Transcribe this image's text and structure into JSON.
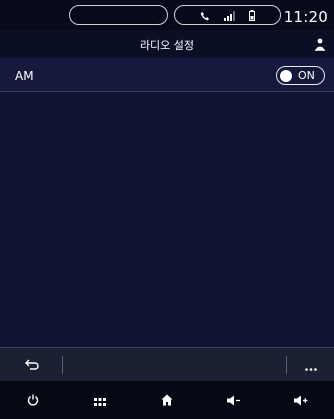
{
  "status": {
    "time": "11:20",
    "icons": [
      "phone-icon",
      "signal-icon",
      "battery-icon"
    ]
  },
  "header": {
    "title": "라디오 설정",
    "user_icon": "person-icon"
  },
  "settings": {
    "am_label": "AM",
    "am_toggle_state": "ON"
  },
  "actionbar": {
    "back_icon": "back-arrow-icon",
    "more_icon": "more-dots-icon"
  },
  "navbar": {
    "items": [
      "power-icon",
      "apps-grid-icon",
      "home-icon",
      "volume-down-icon",
      "volume-up-icon"
    ]
  },
  "colors": {
    "background": "#0e1230",
    "row_background": "#151a3c",
    "text": "#ffffff"
  }
}
